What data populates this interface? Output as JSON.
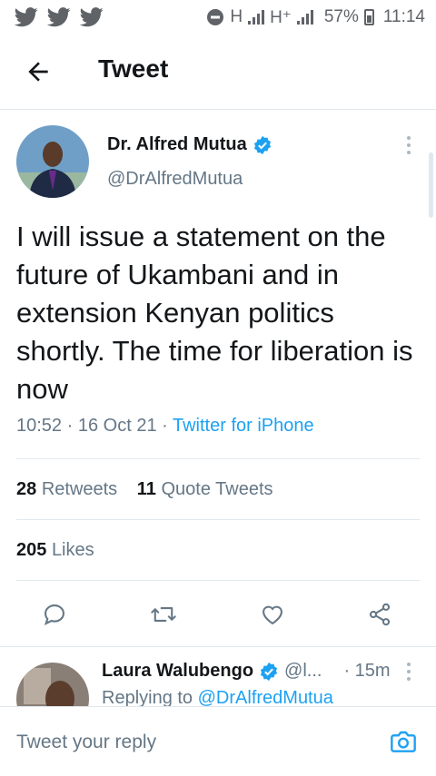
{
  "status_bar": {
    "battery": "57%",
    "time": "11:14",
    "network_1": "H",
    "network_2": "H⁺"
  },
  "header": {
    "title": "Tweet"
  },
  "tweet": {
    "author_name": "Dr. Alfred Mutua",
    "author_handle": "@DrAlfredMutua",
    "text": "I will issue a statement on the future of Ukambani and in extension Kenyan politics shortly. The time for liberation is now",
    "time": "10:52",
    "date": "16 Oct 21",
    "source": "Twitter for iPhone",
    "retweets_count": "28",
    "retweets_label": "Retweets",
    "quote_count": "11",
    "quote_label": "Quote Tweets",
    "likes_count": "205",
    "likes_label": "Likes"
  },
  "reply_preview": {
    "author_name": "Laura Walubengo",
    "author_handle": "@l...",
    "time": "· 15m",
    "replying_label": "Replying to",
    "replying_to": "@DrAlfredMutua"
  },
  "composer": {
    "placeholder": "Tweet your reply"
  },
  "colors": {
    "accent": "#1da1f2",
    "muted": "#657786",
    "border": "#e1e8ed"
  }
}
